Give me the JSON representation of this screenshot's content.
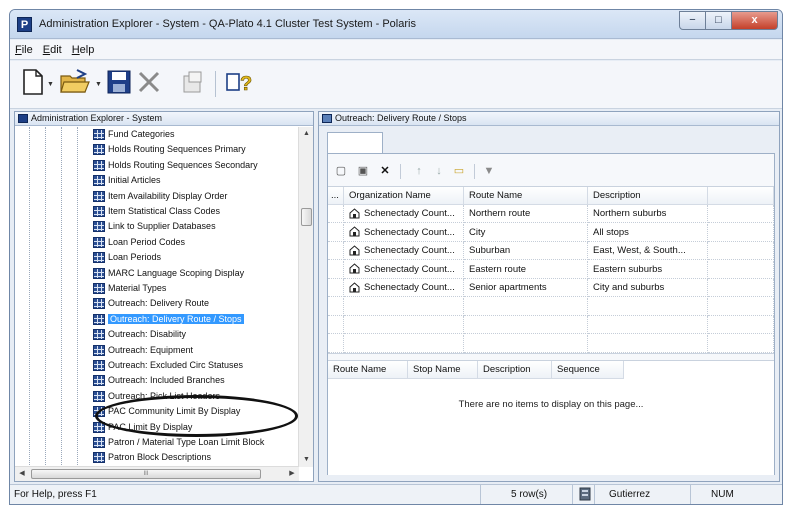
{
  "window": {
    "title": "Administration Explorer - System - QA-Plato 4.1 Cluster Test System - Polaris",
    "app_icon": "P",
    "controls": {
      "minimize": "−",
      "maximize": "□",
      "close": "x"
    }
  },
  "menu": [
    {
      "label": "File",
      "mnemonic": "F",
      "rest": "ile"
    },
    {
      "label": "Edit",
      "mnemonic": "E",
      "rest": "dit"
    },
    {
      "label": "Help",
      "mnemonic": "H",
      "rest": "elp"
    }
  ],
  "toolbar": {
    "icons": [
      "new-document-icon",
      "open-folder-icon",
      "save-disk-icon",
      "delete-x-icon",
      "properties-icon",
      "help-pointer-icon"
    ]
  },
  "left_pane": {
    "header": "Administration Explorer - System",
    "tree_items": [
      {
        "label": "Fund Categories"
      },
      {
        "label": "Holds Routing Sequences Primary"
      },
      {
        "label": "Holds Routing Sequences Secondary"
      },
      {
        "label": "Initial Articles"
      },
      {
        "label": "Item Availability Display Order"
      },
      {
        "label": "Item Statistical Class Codes"
      },
      {
        "label": "Link to Supplier Databases"
      },
      {
        "label": "Loan Period Codes"
      },
      {
        "label": "Loan Periods"
      },
      {
        "label": "MARC Language Scoping Display"
      },
      {
        "label": "Material Types"
      },
      {
        "label": "Outreach: Delivery Route"
      },
      {
        "label": "Outreach: Delivery Route / Stops",
        "selected": true
      },
      {
        "label": "Outreach: Disability"
      },
      {
        "label": "Outreach: Equipment"
      },
      {
        "label": "Outreach: Excluded Circ Statuses"
      },
      {
        "label": "Outreach: Included Branches"
      },
      {
        "label": "Outreach: Pick List Headers"
      },
      {
        "label": "PAC Community Limit By Display"
      },
      {
        "label": "PAC Limit By Display"
      },
      {
        "label": "Patron / Material Type Loan Limit Block"
      },
      {
        "label": "Patron Block Descriptions"
      }
    ],
    "scroll_glyphs": {
      "up": "▲",
      "down": "▼",
      "left": "◀",
      "right": "▶",
      "grip": "III"
    }
  },
  "right_pane": {
    "header": "Outreach: Delivery Route / Stops",
    "grid_toolbar": [
      "new-row-icon",
      "edit-row-icon",
      "delete-row-icon",
      "move-up-icon",
      "move-down-icon",
      "new-folder-icon",
      "filter-icon"
    ],
    "grid_toolbar_glyphs": {
      "new": "▢",
      "edit": "▣",
      "delete": "✕",
      "up": "↑",
      "down": "↓",
      "folder": "▭",
      "filter": "▼"
    },
    "top_grid": {
      "columns": [
        "...",
        "Organization Name",
        "Route Name",
        "Description"
      ],
      "rows": [
        {
          "org": "Schenectady Count...",
          "route": "Northern route",
          "desc": "Northern suburbs"
        },
        {
          "org": "Schenectady Count...",
          "route": "City",
          "desc": "All stops"
        },
        {
          "org": "Schenectady Count...",
          "route": "Suburban",
          "desc": "East, West, & South..."
        },
        {
          "org": "Schenectady Count...",
          "route": "Eastern route",
          "desc": "Eastern suburbs"
        },
        {
          "org": "Schenectady Count...",
          "route": "Senior apartments",
          "desc": "City and suburbs"
        }
      ]
    },
    "bottom_grid": {
      "columns": [
        "Route Name",
        "Stop Name",
        "Description",
        "Sequence"
      ],
      "empty_message": "There are no items to display on this page..."
    }
  },
  "statusbar": {
    "help": "For Help, press F1",
    "rows": "5 row(s)",
    "user": "Gutierrez",
    "num": "NUM"
  },
  "colors": {
    "selection": "#3399ff",
    "title_gradient_top": "#dbe7f6",
    "close_button": "#c4402a",
    "accent_icon": "#1d3f86"
  }
}
